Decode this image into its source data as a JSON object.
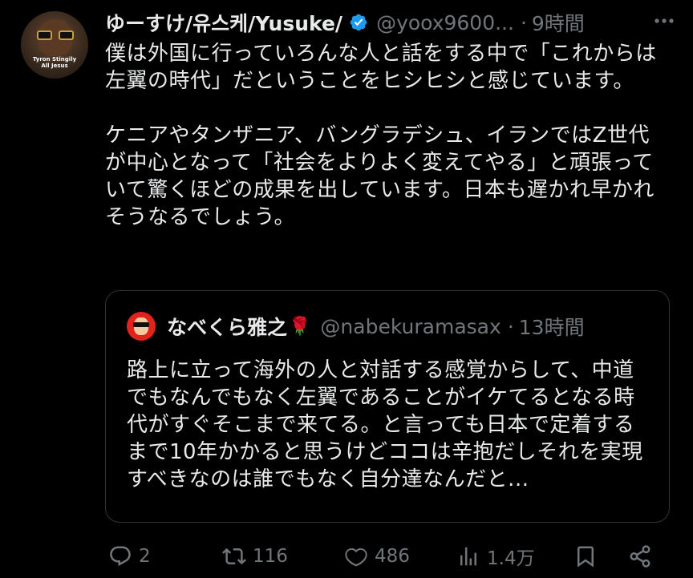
{
  "author": {
    "display_name": "ゆーすけ/유스케/Yusuke/",
    "handle": "@yoox9600...",
    "separator": "·",
    "time": "9時間",
    "avatar_caption": [
      "Tyron Stingily",
      "All Jesus"
    ]
  },
  "tweet": {
    "paragraphs": [
      "僕は外国に行っていろんな人と話をする中で「これからは左翼の時代」だということをヒシヒシと感じています。",
      "ケニアやタンザニア、バングラデシュ、イランではZ世代が中心となって「社会をよりよく変えてやる」と頑張っていて驚くほどの成果を出しています。日本も遅かれ早かれそうなるでしょう。"
    ]
  },
  "quoted": {
    "display_name": "なべくら雅之",
    "emoji": "🌹",
    "handle": "@nabekuramasax",
    "separator": "·",
    "time": "13時間",
    "text": "路上に立って海外の人と対話する感覚からして、中道でもなんでもなく左翼であることがイケてるとなる時代がすぐそこまで来てる。と言っても日本で定着するまで10年かかると思うけどココは辛抱だしそれを実現すべきなのは誰でもなく自分達なんだと..."
  },
  "actions": {
    "reply": "2",
    "repost": "116",
    "like": "486",
    "views": "1.4万"
  },
  "colors": {
    "background": "#000000",
    "text": "#e7e9ea",
    "muted": "#71767b",
    "border": "#2f3336",
    "verified": "#1d9bf0"
  },
  "icons": [
    "verified-badge-icon",
    "more-options-icon",
    "reply-icon",
    "repost-icon",
    "like-icon",
    "views-icon",
    "bookmark-icon",
    "share-icon"
  ]
}
